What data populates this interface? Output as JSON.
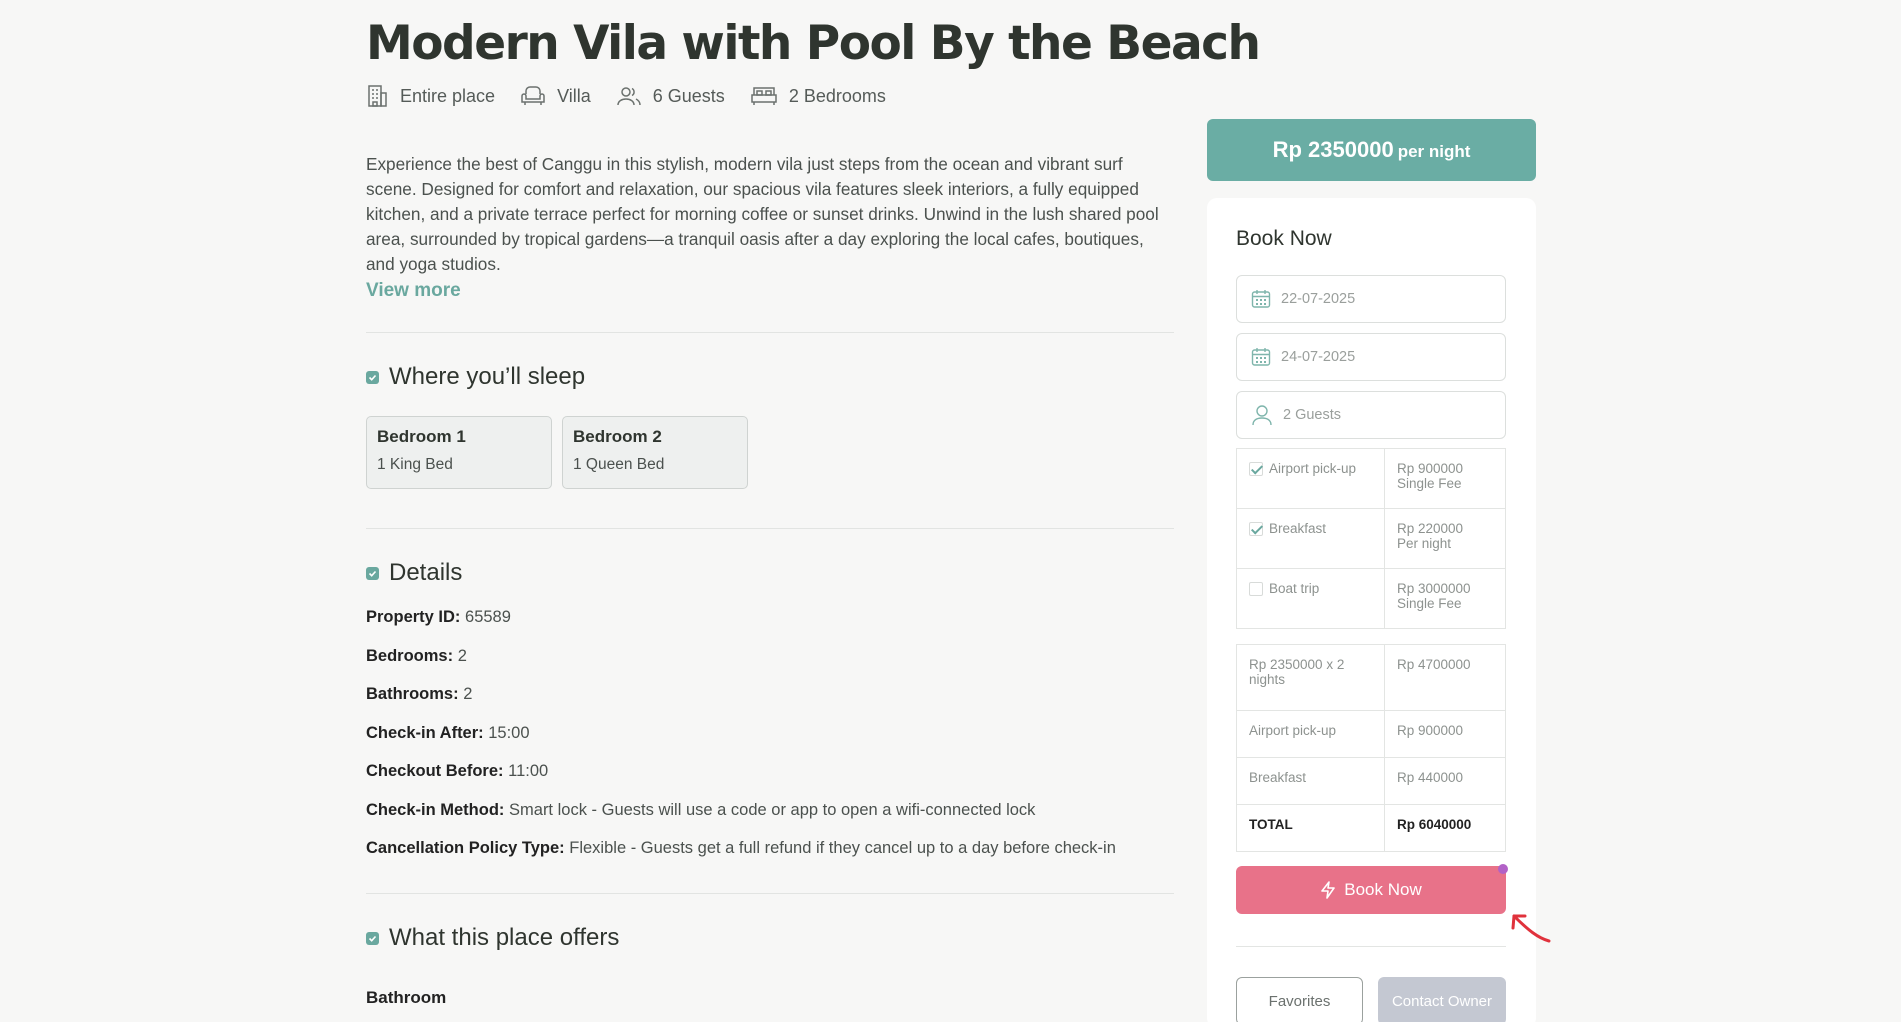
{
  "listing": {
    "title": "Modern Vila with Pool By the Beach",
    "facts": {
      "place": {
        "label": "Entire place",
        "icon": "building-icon"
      },
      "type": {
        "label": "Villa",
        "icon": "armchair-icon"
      },
      "guests": {
        "label": "6 Guests",
        "icon": "users-icon"
      },
      "bedrooms": {
        "label": "2 Bedrooms",
        "icon": "bed-icon"
      }
    },
    "description": "Experience the best of Canggu in this stylish, modern vila just steps from the ocean and vibrant surf scene. Designed for comfort and relaxation, our spacious vila features sleek interiors, a fully equipped kitchen, and a private terrace perfect for morning coffee or sunset drinks. Unwind in the lush shared pool area, surrounded by tropical gardens—a tranquil oasis after a day exploring the local cafes, boutiques, and yoga studios.",
    "view_more": "View more"
  },
  "sleep": {
    "heading": "Where you’ll sleep",
    "rooms": [
      {
        "name": "Bedroom 1",
        "bed": "1 King Bed"
      },
      {
        "name": "Bedroom 2",
        "bed": "1 Queen Bed"
      }
    ]
  },
  "details": {
    "heading": "Details",
    "rows": [
      {
        "label": "Property ID:",
        "value": "65589"
      },
      {
        "label": "Bedrooms:",
        "value": "2"
      },
      {
        "label": "Bathrooms:",
        "value": "2"
      },
      {
        "label": "Check-in After:",
        "value": "15:00"
      },
      {
        "label": "Checkout Before:",
        "value": "11:00"
      },
      {
        "label": "Check-in Method:",
        "value": "Smart lock - Guests will use a code or app to open a wifi-connected lock"
      },
      {
        "label": "Cancellation Policy Type:",
        "value": "Flexible - Guests get a full refund if they cancel up to a day before check-in"
      }
    ]
  },
  "offers": {
    "heading": "What this place offers",
    "first_category": "Bathroom"
  },
  "booking": {
    "price": "Rp 2350000",
    "per_night": "per night",
    "title": "Book Now",
    "checkin": "22-07-2025",
    "checkout": "24-07-2025",
    "guests": "2 Guests",
    "options": [
      {
        "label": "Airport pick-up",
        "checked": true,
        "price": "Rp 900000",
        "unit": "Single Fee"
      },
      {
        "label": "Breakfast",
        "checked": true,
        "price": "Rp 220000",
        "unit": "Per night"
      },
      {
        "label": "Boat trip",
        "checked": false,
        "price": "Rp 3000000",
        "unit": "Single Fee"
      }
    ],
    "summary": [
      {
        "label": "Rp 2350000 x 2 nights",
        "value": "Rp 4700000"
      },
      {
        "label": "Airport pick-up",
        "value": "Rp 900000"
      },
      {
        "label": "Breakfast",
        "value": "Rp 440000"
      }
    ],
    "total": {
      "label": "TOTAL",
      "value": "Rp 6040000"
    },
    "book_button": "Book Now",
    "favorites_button": "Favorites",
    "contact_button": "Contact Owner"
  },
  "colors": {
    "accent": "#6aada4",
    "book_button": "#e87289",
    "contact_button": "#c4c8d2",
    "cursor": "#e0323c"
  }
}
